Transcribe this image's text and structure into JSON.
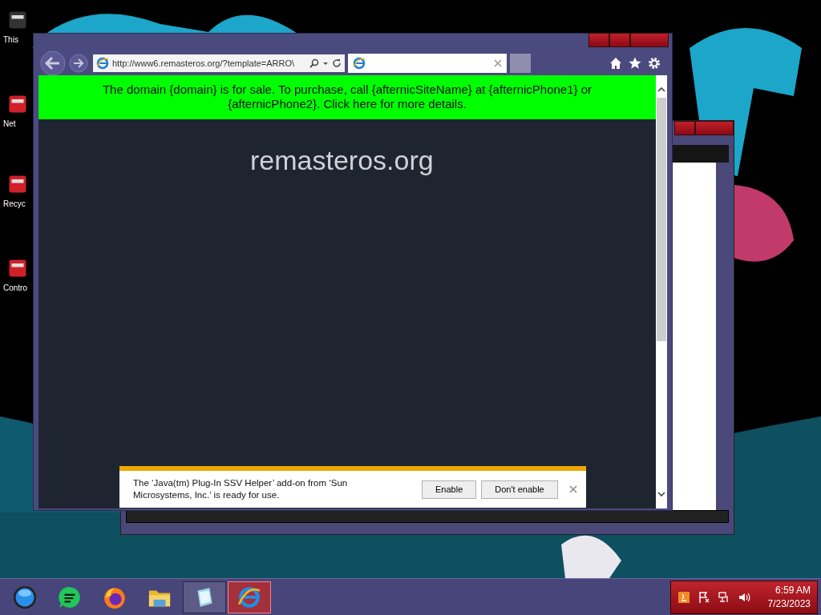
{
  "desktop_icons": [
    {
      "label": "This"
    },
    {
      "label": "Net"
    },
    {
      "label": "Recyc"
    },
    {
      "label": "Contro"
    }
  ],
  "browser": {
    "address": "http://www6.remasteros.org/?template=ARRO\\",
    "banner": "The domain {domain} is for sale. To purchase, call {afternicSiteName} at {afternicPhone1} or {afternicPhone2}. Click here for more details.",
    "site_title": "remasteros.org"
  },
  "notification": {
    "message": "The ‘Java(tm) Plug-In SSV Helper’ add-on from ‘Sun Microsystems, Inc.’ is ready for use.",
    "buttons": [
      "Enable",
      "Don't enable"
    ]
  },
  "taskbar": {
    "apps": [
      {
        "kind": "start",
        "open": false,
        "selected": false
      },
      {
        "kind": "chat",
        "open": false,
        "selected": false
      },
      {
        "kind": "firefox",
        "open": false,
        "selected": false
      },
      {
        "kind": "folder",
        "open": false,
        "selected": false
      },
      {
        "kind": "notepad",
        "open": true,
        "selected": false
      },
      {
        "kind": "ie",
        "open": true,
        "selected": true
      }
    ],
    "time": "6:59 AM",
    "date": "7/23/2023"
  }
}
